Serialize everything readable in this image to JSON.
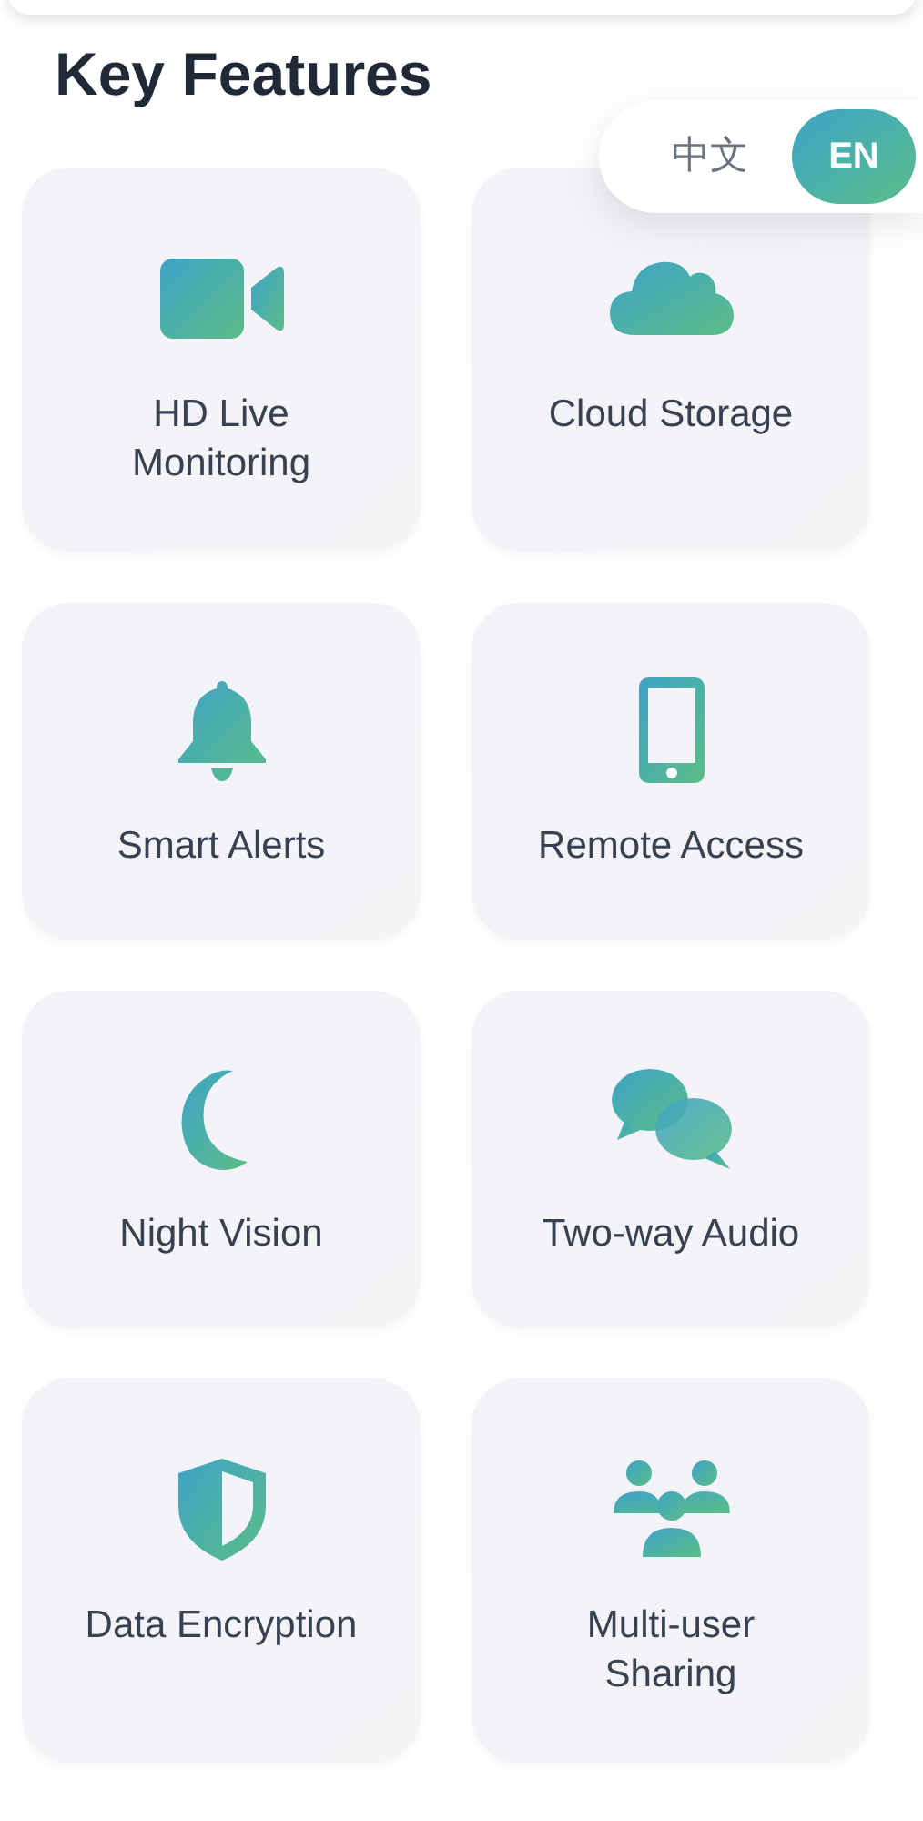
{
  "title": "Key Features",
  "language_toggle": [
    {
      "label": "中文",
      "selected": false
    },
    {
      "label": "EN",
      "selected": true
    }
  ],
  "features": [
    {
      "label": "HD Live Monitoring"
    },
    {
      "label": "Cloud Storage"
    },
    {
      "label": "Smart Alerts"
    },
    {
      "label": "Remote Access"
    },
    {
      "label": "Night Vision"
    },
    {
      "label": "Two-way Audio"
    },
    {
      "label": "Data Encryption"
    },
    {
      "label": "Multi-user Sharing"
    }
  ]
}
